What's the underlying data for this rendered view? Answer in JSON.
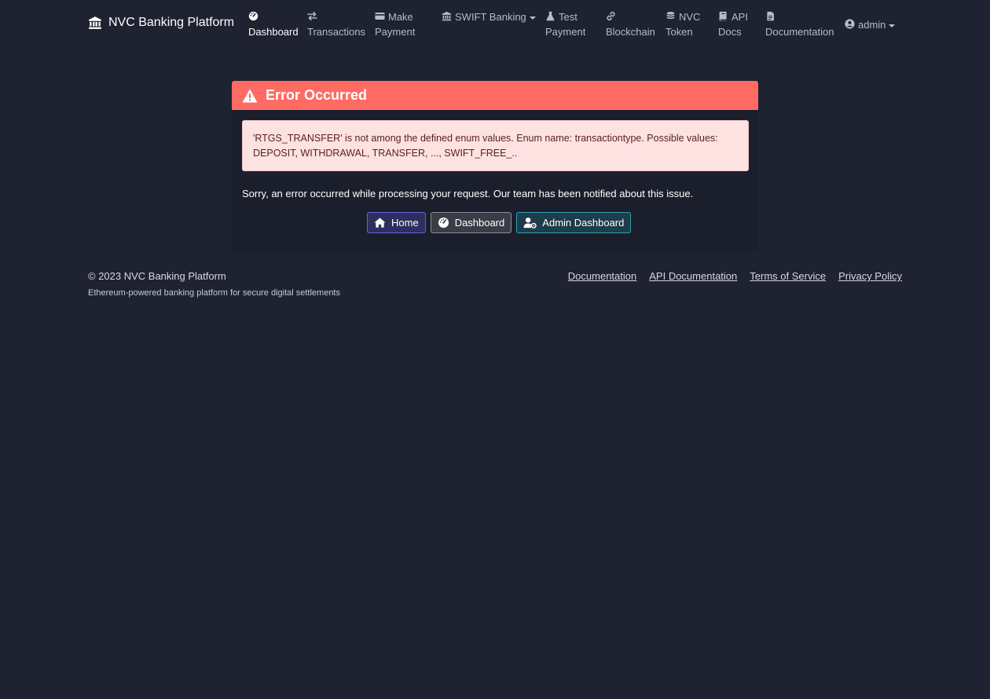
{
  "navbar": {
    "brand": "NVC Banking Platform",
    "items": [
      {
        "line1": "",
        "line2": "Dashboard",
        "icon": "tachometer-icon"
      },
      {
        "line1": "",
        "line2": "Transactions",
        "icon": "exchange-icon"
      },
      {
        "line1": "Make",
        "line2": "Payment",
        "icon": "credit-card-icon"
      },
      {
        "line1": "SWIFT Banking",
        "line2": "",
        "icon": "bank-icon"
      },
      {
        "line1": "Test",
        "line2": "Payment",
        "icon": "flask-icon"
      },
      {
        "line1": "",
        "line2": "Blockchain",
        "icon": "link-icon"
      },
      {
        "line1": "NVC",
        "line2": "Token",
        "icon": "coins-icon"
      },
      {
        "line1": "API",
        "line2": "Docs",
        "icon": "book-icon"
      },
      {
        "line1": "",
        "line2": "Documentation",
        "icon": "file-icon"
      }
    ],
    "user": "admin"
  },
  "error": {
    "title": "Error Occurred",
    "detail": "'RTGS_TRANSFER' is not among the defined enum values. Enum name: transactiontype. Possible values: DEPOSIT, WITHDRAWAL, TRANSFER, ..., SWIFT_FREE_..",
    "message": "Sorry, an error occurred while processing your request. Our team has been notified about this issue.",
    "buttons": {
      "home": "Home",
      "dashboard": "Dashboard",
      "admin": "Admin Dashboard"
    }
  },
  "footer": {
    "copyright": "© 2023 NVC Banking Platform",
    "tagline": "Ethereum-powered banking platform for secure digital settlements",
    "links": [
      "Documentation",
      "API Documentation",
      "Terms of Service",
      "Privacy Policy"
    ]
  },
  "colors": {
    "background": "#1e2231",
    "error_header": "#ff6b63",
    "alert_bg": "#fde2e2"
  }
}
